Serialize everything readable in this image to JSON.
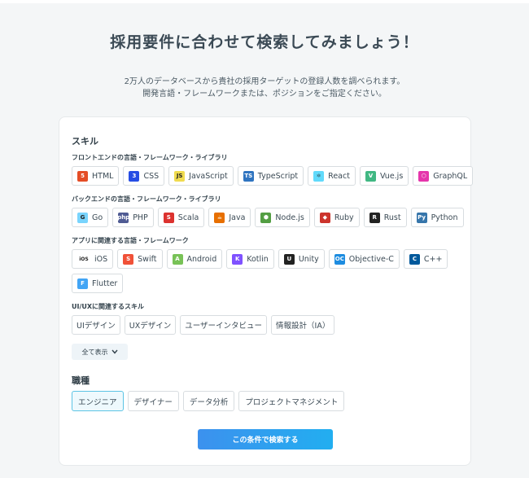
{
  "page": {
    "title": "採用要件に合わせて検索してみましょう！",
    "subtitle_line1": "2万人のデータベースから貴社の採用ターゲットの登録人数を調べられます。",
    "subtitle_line2": "開発言語・フレームワークまたは、ポジションをご指定ください。"
  },
  "skills": {
    "heading": "スキル",
    "frontend": {
      "heading": "フロントエンドの言語・フレームワーク・ライブラリ",
      "items": [
        {
          "label": "HTML",
          "icon": "html5-icon",
          "color": "#e44d26",
          "glyph": "5"
        },
        {
          "label": "CSS",
          "icon": "css3-icon",
          "color": "#264de4",
          "glyph": "3"
        },
        {
          "label": "JavaScript",
          "icon": "javascript-icon",
          "color": "#f0db4f",
          "glyph": "JS"
        },
        {
          "label": "TypeScript",
          "icon": "typescript-icon",
          "color": "#2f74c0",
          "glyph": "TS"
        },
        {
          "label": "React",
          "icon": "react-icon",
          "color": "#61dafb",
          "glyph": "⚛"
        },
        {
          "label": "Vue.js",
          "icon": "vue-icon",
          "color": "#41b883",
          "glyph": "V"
        },
        {
          "label": "GraphQL",
          "icon": "graphql-icon",
          "color": "#e535ab",
          "glyph": "⬡"
        }
      ]
    },
    "backend": {
      "heading": "バックエンドの言語・フレームワーク・ライブラリ",
      "items": [
        {
          "label": "Go",
          "icon": "go-icon",
          "color": "#79d4fd",
          "glyph": "G"
        },
        {
          "label": "PHP",
          "icon": "php-icon",
          "color": "#4f5b93",
          "glyph": "php"
        },
        {
          "label": "Scala",
          "icon": "scala-icon",
          "color": "#dc322f",
          "glyph": "S"
        },
        {
          "label": "Java",
          "icon": "java-icon",
          "color": "#e76f00",
          "glyph": "☕"
        },
        {
          "label": "Node.js",
          "icon": "nodejs-icon",
          "color": "#539e43",
          "glyph": "⬢"
        },
        {
          "label": "Ruby",
          "icon": "ruby-icon",
          "color": "#cc342d",
          "glyph": "◆"
        },
        {
          "label": "Rust",
          "icon": "rust-icon",
          "color": "#222222",
          "glyph": "R"
        },
        {
          "label": "Python",
          "icon": "python-icon",
          "color": "#3776ab",
          "glyph": "Py"
        }
      ]
    },
    "mobile": {
      "heading": "アプリに関連する言語・フレームワーク",
      "items": [
        {
          "label": "iOS",
          "icon": "ios-icon",
          "color": "#ffffff",
          "glyph": "iOS"
        },
        {
          "label": "Swift",
          "icon": "swift-icon",
          "color": "#f05138",
          "glyph": "S"
        },
        {
          "label": "Android",
          "icon": "android-icon",
          "color": "#78c257",
          "glyph": "A"
        },
        {
          "label": "Kotlin",
          "icon": "kotlin-icon",
          "color": "#7f52ff",
          "glyph": "K"
        },
        {
          "label": "Unity",
          "icon": "unity-icon",
          "color": "#222222",
          "glyph": "U"
        },
        {
          "label": "Objective-C",
          "icon": "objective-c-icon",
          "color": "#1d8ce0",
          "glyph": "OC"
        },
        {
          "label": "C++",
          "icon": "cpp-icon",
          "color": "#00599c",
          "glyph": "C"
        },
        {
          "label": "Flutter",
          "icon": "flutter-icon",
          "color": "#42a5f5",
          "glyph": "F"
        }
      ]
    },
    "design": {
      "heading": "UI/UXに関連するスキル",
      "items": [
        {
          "label": "UIデザイン"
        },
        {
          "label": "UXデザイン"
        },
        {
          "label": "ユーザーインタビュー"
        },
        {
          "label": "情報設計（IA）"
        }
      ]
    },
    "show_all": "全て表示"
  },
  "jobs": {
    "heading": "職種",
    "items": [
      {
        "label": "エンジニア",
        "selected": true
      },
      {
        "label": "デザイナー",
        "selected": false
      },
      {
        "label": "データ分析",
        "selected": false
      },
      {
        "label": "プロジェクトマネジメント",
        "selected": false
      }
    ]
  },
  "search_button": "この条件で検索する",
  "colors": {
    "accent_start": "#3c91ee",
    "accent_end": "#22aef0",
    "selected_border": "#5cc4e4"
  }
}
